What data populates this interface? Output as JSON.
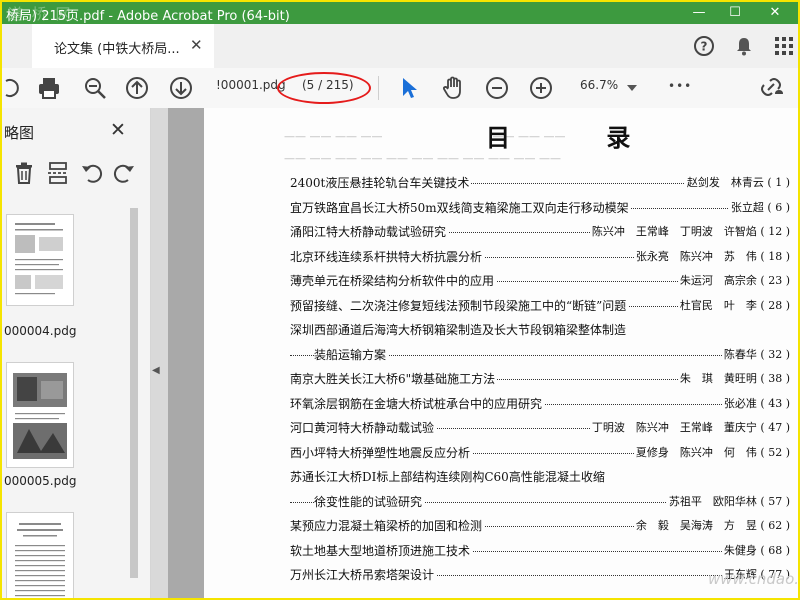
{
  "window": {
    "title": "桥局) 215页.pdf - Adobe Acrobat Pro (64-bit)",
    "watermark_text": "道 桥 网",
    "minimize": "—",
    "maximize": "☐",
    "close": "✕"
  },
  "tab": {
    "label": "论文集 (中铁大桥局...",
    "close": "✕"
  },
  "toolbar": {
    "page_field": "!00001.pdg",
    "page_count": "(5 / 215)",
    "zoom": "66.7%",
    "more": "•••"
  },
  "left_pane": {
    "title": "略图",
    "close": "✕",
    "thumbnails": [
      {
        "label": "000004.pdg"
      },
      {
        "label": "000005.pdg"
      }
    ]
  },
  "document": {
    "heading": "目 录",
    "entries": [
      {
        "title": "2400t液压悬挂轮轨台车关键技术",
        "authors": "赵剑发　林青云 ( 1 )"
      },
      {
        "title": "宜万铁路宜昌长江大桥50m双线简支箱梁施工双向走行移动模架",
        "authors": "张立超 ( 6 )"
      },
      {
        "title": "涌阳江特大桥静动载试验研究",
        "authors": "陈兴冲　王常峰　丁明波　许智焰 ( 12 )"
      },
      {
        "title": "北京环线连续系杆拱特大桥抗震分析",
        "authors": "张永亮　陈兴冲　苏　伟 ( 18 )"
      },
      {
        "title": "薄壳单元在桥梁结构分析软件中的应用",
        "authors": "朱运河　高宗余 ( 23 )"
      },
      {
        "title": "预留接缝、二次浇注修复短线法预制节段梁施工中的“断链”问题",
        "authors": "杜官民　叶　李 ( 28 )"
      },
      {
        "title": "深圳西部通道后海湾大桥钢箱梁制造及长大节段钢箱梁整体制造",
        "authors": ""
      },
      {
        "title": "装船运输方案",
        "authors": "陈春华 ( 32 )",
        "indent": true
      },
      {
        "title": "南京大胜关长江大桥6\"墩基础施工方法",
        "authors": "朱　琪　黄旺明 ( 38 )"
      },
      {
        "title": "环氧涂层钢筋在金塘大桥试桩承台中的应用研究",
        "authors": "张必准 ( 43 )"
      },
      {
        "title": "河口黄河特大桥静动载试验",
        "authors": "丁明波　陈兴冲　王常峰　董庆宁 ( 47 )"
      },
      {
        "title": "西小坪特大桥弹塑性地震反应分析",
        "authors": "夏修身　陈兴冲　何　伟 ( 52 )"
      },
      {
        "title": "苏通长江大桥DI标上部结构连续刚构C60高性能混凝土收缩",
        "authors": ""
      },
      {
        "title": "徐变性能的试验研究",
        "authors": "苏祖平　欧阳华林 ( 57 )",
        "indent": true
      },
      {
        "title": "某预应力混凝土箱梁桥的加固和检测",
        "authors": "余　毅　吴海涛　方　昱 ( 62 )"
      },
      {
        "title": "软土地基大型地道桥顶进施工技术",
        "authors": "朱健身 ( 68 )"
      },
      {
        "title": "万州长江大桥吊索塔架设计",
        "authors": "王东辉 ( 77 )"
      }
    ],
    "corner_watermark": "www.cndao.com"
  }
}
